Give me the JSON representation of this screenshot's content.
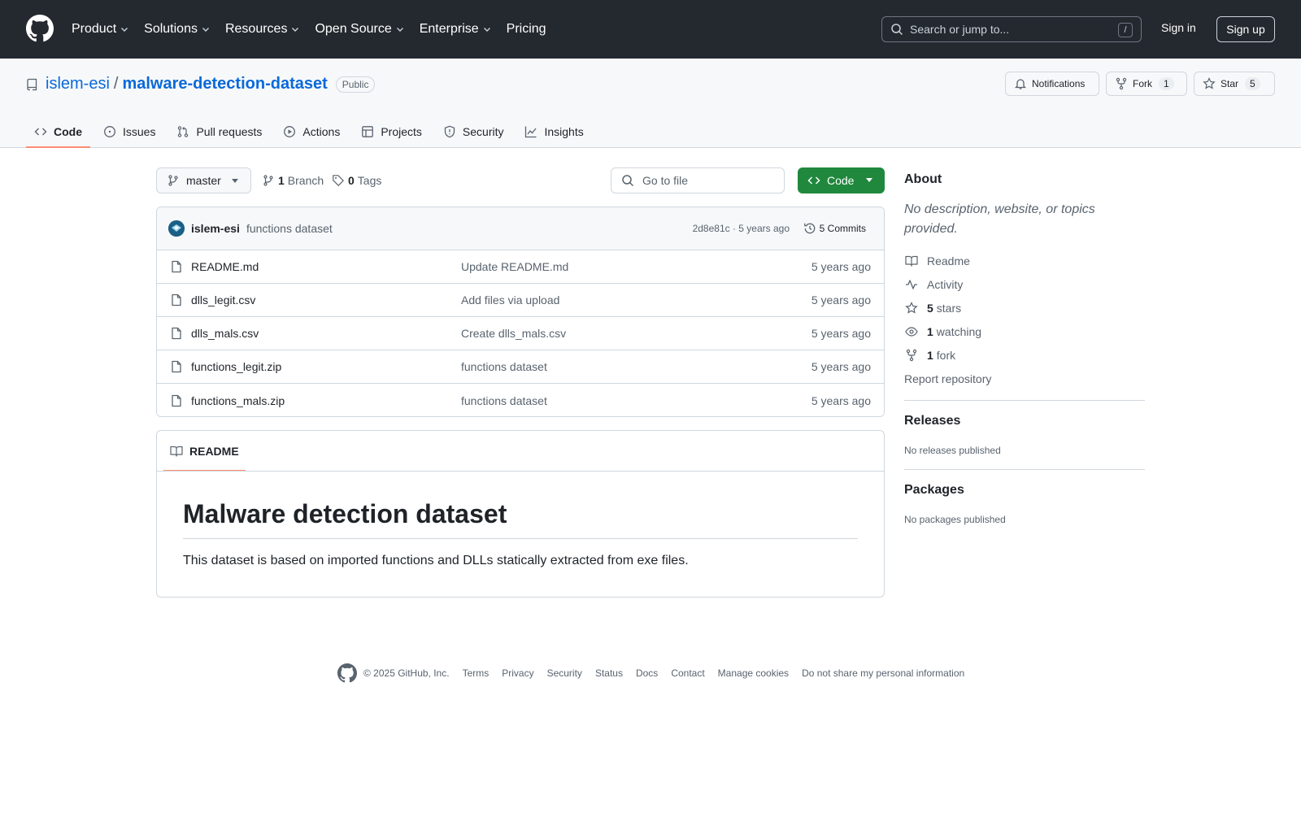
{
  "header": {
    "nav": [
      "Product",
      "Solutions",
      "Resources",
      "Open Source",
      "Enterprise",
      "Pricing"
    ],
    "search_placeholder": "Search or jump to...",
    "search_key": "/",
    "signin": "Sign in",
    "signup": "Sign up"
  },
  "repo": {
    "owner": "islem-esi",
    "slash": "/",
    "name": "malware-detection-dataset",
    "visibility": "Public",
    "notifications": "Notifications",
    "fork_label": "Fork",
    "fork_count": "1",
    "star_label": "Star",
    "star_count": "5",
    "tabs": [
      "Code",
      "Issues",
      "Pull requests",
      "Actions",
      "Projects",
      "Security",
      "Insights"
    ]
  },
  "toolbar": {
    "branch": "master",
    "branches_count": "1",
    "branches_label": "Branch",
    "tags_count": "0",
    "tags_label": "Tags",
    "goto_placeholder": "Go to file",
    "code_button": "Code"
  },
  "commit": {
    "author": "islem-esi",
    "message": "functions dataset",
    "sha_time": "2d8e81c · 5 years ago",
    "commits": "5 Commits"
  },
  "files": [
    {
      "name": "README.md",
      "message": "Update README.md",
      "time": "5 years ago"
    },
    {
      "name": "dlls_legit.csv",
      "message": "Add files via upload",
      "time": "5 years ago"
    },
    {
      "name": "dlls_mals.csv",
      "message": "Create dlls_mals.csv",
      "time": "5 years ago"
    },
    {
      "name": "functions_legit.zip",
      "message": "functions dataset",
      "time": "5 years ago"
    },
    {
      "name": "functions_mals.zip",
      "message": "functions dataset",
      "time": "5 years ago"
    }
  ],
  "readme": {
    "tab": "README",
    "title": "Malware detection dataset",
    "body": "This dataset is based on imported functions and DLLs statically extracted from exe files."
  },
  "about": {
    "title": "About",
    "description": "No description, website, or topics provided.",
    "readme": "Readme",
    "activity": "Activity",
    "stars_count": "5",
    "stars_label": "stars",
    "watching_count": "1",
    "watching_label": "watching",
    "fork_count": "1",
    "fork_label": "fork",
    "report": "Report repository"
  },
  "releases": {
    "title": "Releases",
    "empty": "No releases published"
  },
  "packages": {
    "title": "Packages",
    "empty": "No packages published"
  },
  "footer": {
    "copyright": "© 2025 GitHub, Inc.",
    "links": [
      "Terms",
      "Privacy",
      "Security",
      "Status",
      "Docs",
      "Contact",
      "Manage cookies",
      "Do not share my personal information"
    ]
  }
}
